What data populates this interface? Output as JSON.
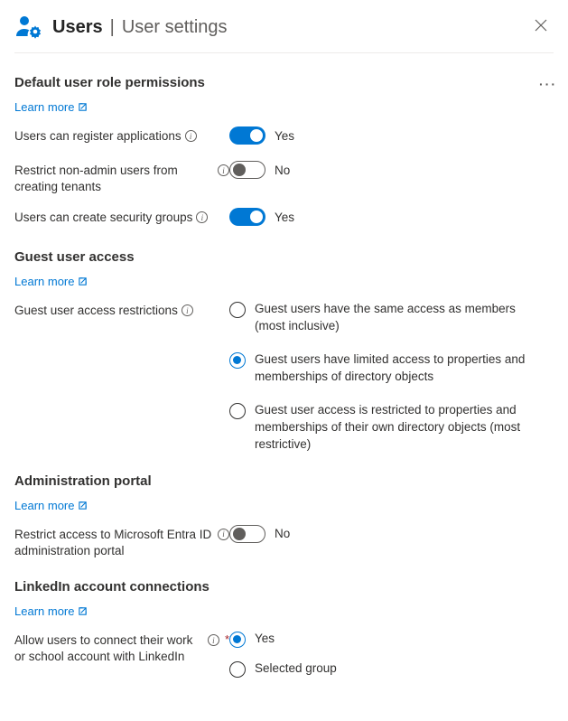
{
  "header": {
    "title_bold": "Users",
    "title_sub": "User settings",
    "icon": "users-gear-icon",
    "close_icon": "close-icon"
  },
  "sections": {
    "default_user_role": {
      "title": "Default user role permissions",
      "learn_more": "Learn more",
      "settings": {
        "register_apps": {
          "label": "Users can register applications",
          "state_text": "Yes",
          "on": true
        },
        "restrict_tenants": {
          "label": "Restrict non-admin users from creating tenants",
          "state_text": "No",
          "on": false
        },
        "security_groups": {
          "label": "Users can create security groups",
          "state_text": "Yes",
          "on": true
        }
      }
    },
    "guest_access": {
      "title": "Guest user access",
      "learn_more": "Learn more",
      "label": "Guest user access restrictions",
      "options": [
        {
          "text": "Guest users have the same access as members (most inclusive)",
          "selected": false
        },
        {
          "text": "Guest users have limited access to properties and memberships of directory objects",
          "selected": true
        },
        {
          "text": "Guest user access is restricted to properties and memberships of their own directory objects (most restrictive)",
          "selected": false
        }
      ]
    },
    "admin_portal": {
      "title": "Administration portal",
      "learn_more": "Learn more",
      "settings": {
        "restrict_portal": {
          "label": "Restrict access to Microsoft Entra ID administration portal",
          "state_text": "No",
          "on": false
        }
      }
    },
    "linkedin": {
      "title": "LinkedIn account connections",
      "learn_more": "Learn more",
      "label": "Allow users to connect their work or school account with LinkedIn",
      "required": true,
      "options": [
        {
          "text": "Yes",
          "selected": true
        },
        {
          "text": "Selected group",
          "selected": false
        }
      ]
    }
  }
}
